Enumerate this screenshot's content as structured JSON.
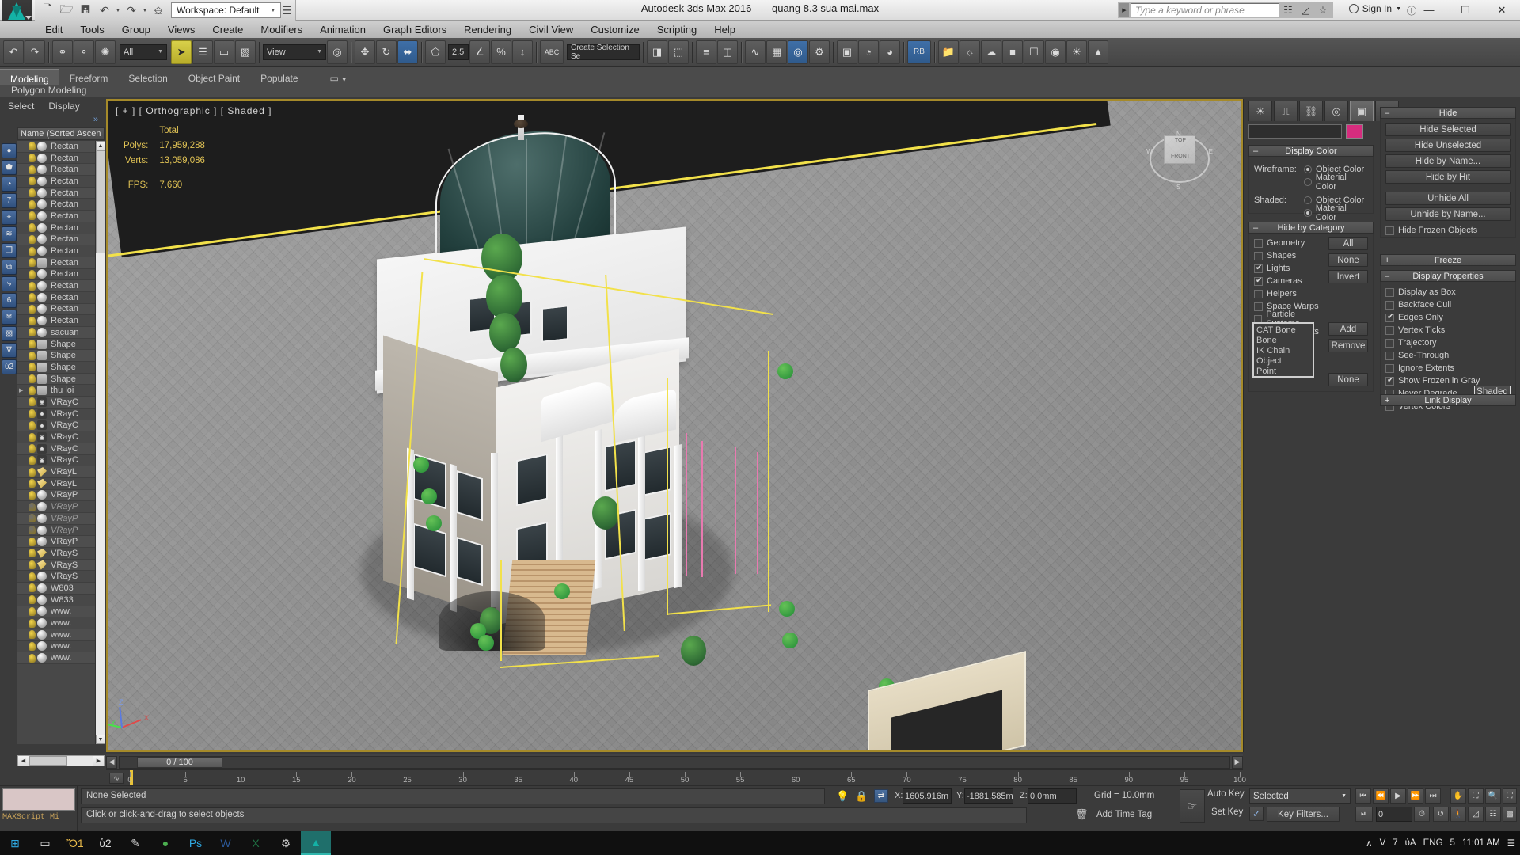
{
  "titlebar": {
    "app_title": "Autodesk 3ds Max 2016",
    "file_name": "quang 8.3 sua mai.max",
    "workspace": "Workspace: Default",
    "search_placeholder": "Type a keyword or phrase",
    "sign_in": "Sign In",
    "logo_label": "MAX",
    "quick_access": [
      {
        "name": "new-file-icon",
        "glyph": "☐"
      },
      {
        "name": "open-file-icon",
        "glyph": "Ὄ2"
      },
      {
        "name": "save-file-icon",
        "glyph": "ὋE"
      },
      {
        "name": "undo-icon",
        "glyph": "↶"
      },
      {
        "name": "redo-icon",
        "glyph": "↷"
      },
      {
        "name": "set-project-folder-icon",
        "glyph": "⌸"
      }
    ],
    "right_icons": [
      {
        "name": "search-binoculars-icon",
        "glyph": "⋈"
      },
      {
        "name": "communication-center-icon",
        "glyph": "⧉"
      },
      {
        "name": "favorites-star-icon",
        "glyph": "☆"
      },
      {
        "name": "help-icon",
        "glyph": "?"
      }
    ],
    "window_buttons": [
      {
        "name": "minimize-button",
        "glyph": "—"
      },
      {
        "name": "restore-button",
        "glyph": "❐"
      },
      {
        "name": "close-button",
        "glyph": "✕"
      }
    ]
  },
  "menubar": {
    "items": [
      "Edit",
      "Tools",
      "Group",
      "Views",
      "Create",
      "Modifiers",
      "Animation",
      "Graph Editors",
      "Rendering",
      "Civil View",
      "Customize",
      "Scripting",
      "Help"
    ]
  },
  "toolbar": {
    "selection_filter": "All",
    "reference_coord": "View",
    "angle_snap_value": "2.5",
    "named_selection_placeholder": "Create Selection Se",
    "buttons": [
      {
        "name": "undo-scene-op-icon",
        "glyph": "↶"
      },
      {
        "name": "redo-scene-op-icon",
        "glyph": "↷"
      },
      {
        "name": "select-link-icon",
        "glyph": "⚭"
      },
      {
        "name": "unlink-selection-icon",
        "glyph": "⚬"
      },
      {
        "name": "bind-space-warp-icon",
        "glyph": "✲"
      },
      {
        "name": "select-object-icon",
        "glyph": "➤"
      },
      {
        "name": "select-by-name-icon",
        "glyph": "☰"
      },
      {
        "name": "rectangular-select-region-icon",
        "glyph": "▭"
      },
      {
        "name": "window-crossing-icon",
        "glyph": "▧"
      },
      {
        "name": "select-and-move-icon",
        "glyph": "✥"
      },
      {
        "name": "select-and-rotate-icon",
        "glyph": "↻"
      },
      {
        "name": "select-and-scale-icon",
        "glyph": "⬌"
      },
      {
        "name": "snaps-toggle-icon",
        "glyph": "⬠"
      },
      {
        "name": "angle-snap-toggle-icon",
        "glyph": "∠"
      },
      {
        "name": "percent-snap-toggle-icon",
        "glyph": "%"
      },
      {
        "name": "spinner-snap-toggle-icon",
        "glyph": "↕"
      },
      {
        "name": "edit-named-selection-icon",
        "glyph": "ABC"
      },
      {
        "name": "mirror-icon",
        "glyph": "⧉"
      },
      {
        "name": "align-icon",
        "glyph": "⬚"
      },
      {
        "name": "layer-explorer-icon",
        "glyph": "≡"
      },
      {
        "name": "curve-editor-icon",
        "glyph": "∿"
      },
      {
        "name": "schematic-view-icon",
        "glyph": "▦"
      },
      {
        "name": "material-editor-icon",
        "glyph": "◎"
      },
      {
        "name": "render-setup-icon",
        "glyph": "⚙"
      },
      {
        "name": "rendered-frame-window-icon",
        "glyph": "▣"
      },
      {
        "name": "render-production-icon",
        "glyph": "☕"
      },
      {
        "name": "render-iterative-icon",
        "glyph": "◑"
      },
      {
        "name": "activeshade-icon",
        "glyph": "◕"
      },
      {
        "name": "project-folder-icon",
        "glyph": "Ὄ1"
      },
      {
        "name": "ribbon-toggle-icon",
        "glyph": "RB"
      }
    ]
  },
  "ribbon": {
    "tabs": [
      {
        "label": "Modeling",
        "active": true
      },
      {
        "label": "Freeform",
        "active": false
      },
      {
        "label": "Selection",
        "active": false
      },
      {
        "label": "Object Paint",
        "active": false
      },
      {
        "label": "Populate",
        "active": false
      }
    ],
    "panel_label": "Polygon Modeling"
  },
  "explorer": {
    "tabs": [
      "Select",
      "Display"
    ],
    "column_header": "Name (Sorted Ascen",
    "side_tools": [
      {
        "name": "select-all-icon",
        "glyph": "●"
      },
      {
        "name": "select-geometry-icon",
        "glyph": "⬟"
      },
      {
        "name": "select-lights-icon",
        "glyph": "◔"
      },
      {
        "name": "select-cameras-icon",
        "glyph": "὏7"
      },
      {
        "name": "select-helpers-icon",
        "glyph": "⌖"
      },
      {
        "name": "select-spacewarps-icon",
        "glyph": "≋"
      },
      {
        "name": "select-groups-icon",
        "glyph": "❐"
      },
      {
        "name": "select-xrefs-icon",
        "glyph": "⧉"
      },
      {
        "name": "select-bones-icon",
        "glyph": "⤷"
      },
      {
        "name": "select-containers-icon",
        "glyph": "὎6"
      },
      {
        "name": "select-frozen-icon",
        "glyph": "❄"
      },
      {
        "name": "select-hidden-icon",
        "glyph": "▧"
      },
      {
        "name": "display-filter-icon",
        "glyph": "∇"
      },
      {
        "name": "lock-selection-icon",
        "glyph": "ὑ2"
      }
    ],
    "rows": [
      {
        "name": "Rectan",
        "type": "geom",
        "on": true
      },
      {
        "name": "Rectan",
        "type": "geom",
        "on": true
      },
      {
        "name": "Rectan",
        "type": "geom",
        "on": true
      },
      {
        "name": "Rectan",
        "type": "geom",
        "on": true
      },
      {
        "name": "Rectan",
        "type": "geom",
        "on": true
      },
      {
        "name": "Rectan",
        "type": "geom",
        "on": true
      },
      {
        "name": "Rectan",
        "type": "geom",
        "on": true
      },
      {
        "name": "Rectan",
        "type": "geom",
        "on": true
      },
      {
        "name": "Rectan",
        "type": "geom",
        "on": true
      },
      {
        "name": "Rectan",
        "type": "geom",
        "on": true
      },
      {
        "name": "Rectan",
        "type": "shape",
        "on": true
      },
      {
        "name": "Rectan",
        "type": "geom",
        "on": true
      },
      {
        "name": "Rectan",
        "type": "geom",
        "on": true
      },
      {
        "name": "Rectan",
        "type": "geom",
        "on": true
      },
      {
        "name": "Rectan",
        "type": "geom",
        "on": true
      },
      {
        "name": "Rectan",
        "type": "geom",
        "on": true
      },
      {
        "name": "sacuan",
        "type": "geom",
        "on": true
      },
      {
        "name": "Shape",
        "type": "shape",
        "on": true
      },
      {
        "name": "Shape",
        "type": "shape",
        "on": true
      },
      {
        "name": "Shape",
        "type": "shape",
        "on": true
      },
      {
        "name": "Shape",
        "type": "shape",
        "on": true
      },
      {
        "name": "thu loi",
        "type": "group",
        "on": true,
        "expander": true
      },
      {
        "name": "VRayC",
        "type": "cam",
        "on": true
      },
      {
        "name": "VRayC",
        "type": "cam",
        "on": true
      },
      {
        "name": "VRayC",
        "type": "cam",
        "on": true
      },
      {
        "name": "VRayC",
        "type": "cam",
        "on": true
      },
      {
        "name": "VRayC",
        "type": "cam",
        "on": true
      },
      {
        "name": "VRayC",
        "type": "cam",
        "on": true
      },
      {
        "name": "VRayL",
        "type": "light",
        "on": true
      },
      {
        "name": "VRayL",
        "type": "light",
        "on": true
      },
      {
        "name": "VRayP",
        "type": "geom",
        "on": true
      },
      {
        "name": "VRayP",
        "type": "geom",
        "on": false
      },
      {
        "name": "VRayP",
        "type": "geom",
        "on": false
      },
      {
        "name": "VRayP",
        "type": "geom",
        "on": false
      },
      {
        "name": "VRayP",
        "type": "geom",
        "on": true
      },
      {
        "name": "VRayS",
        "type": "light",
        "on": true
      },
      {
        "name": "VRayS",
        "type": "light",
        "on": true
      },
      {
        "name": "VRayS",
        "type": "geom",
        "on": true
      },
      {
        "name": "W803",
        "type": "geom",
        "on": true
      },
      {
        "name": "W833",
        "type": "geom",
        "on": true
      },
      {
        "name": "www.",
        "type": "geom",
        "on": true
      },
      {
        "name": "www.",
        "type": "geom",
        "on": true
      },
      {
        "name": "www.",
        "type": "geom",
        "on": true
      },
      {
        "name": "www.",
        "type": "geom",
        "on": true
      },
      {
        "name": "www.",
        "type": "geom",
        "on": true
      }
    ]
  },
  "viewport": {
    "label": "[ + ] [ Orthographic ] [ Shaded ]",
    "stats": {
      "header": "Total",
      "polys_label": "Polys:",
      "polys_value": "17,959,288",
      "verts_label": "Verts:",
      "verts_value": "13,059,086",
      "fps_label": "FPS:",
      "fps_value": "7.660"
    },
    "viewcube": {
      "top": "TOP",
      "front": "FRONT",
      "n": "N",
      "e": "E",
      "s": "S",
      "w": "W"
    },
    "axis": {
      "x": "X",
      "y": "Y",
      "z": "Z"
    }
  },
  "command_panel": {
    "tabs": [
      {
        "name": "create-tab",
        "glyph": "☀",
        "active": false
      },
      {
        "name": "modify-tab",
        "glyph": "⎍",
        "active": false
      },
      {
        "name": "hierarchy-tab",
        "glyph": "⛓",
        "active": false
      },
      {
        "name": "motion-tab",
        "glyph": "◎",
        "active": false
      },
      {
        "name": "display-tab",
        "glyph": "▣",
        "active": true
      },
      {
        "name": "utilities-tab",
        "glyph": "⚒",
        "active": false
      }
    ],
    "object_name": "",
    "object_color": "#d62c7e",
    "display_color": {
      "title": "Display Color",
      "wireframe_label": "Wireframe:",
      "shaded_label": "Shaded:",
      "options": [
        "Object Color",
        "Material Color"
      ],
      "wireframe_selected": "Object Color",
      "shaded_selected": "Material Color"
    },
    "hide_by_category": {
      "title": "Hide by Category",
      "items": [
        {
          "label": "Geometry",
          "checked": false
        },
        {
          "label": "Shapes",
          "checked": false
        },
        {
          "label": "Lights",
          "checked": true
        },
        {
          "label": "Cameras",
          "checked": true
        },
        {
          "label": "Helpers",
          "checked": false
        },
        {
          "label": "Space Warps",
          "checked": false
        },
        {
          "label": "Particle Systems",
          "checked": false
        },
        {
          "label": "Bone Objects",
          "checked": false
        }
      ],
      "buttons": [
        "All",
        "None",
        "Invert"
      ],
      "list_items": [
        "CAT Bone",
        "Bone",
        "IK Chain Object",
        "Point"
      ],
      "side_buttons": [
        "Add",
        "Remove",
        "None"
      ]
    },
    "hide": {
      "title": "Hide",
      "buttons": [
        "Hide Selected",
        "Hide Unselected",
        "Hide by Name...",
        "Hide by Hit",
        "Unhide All",
        "Unhide by Name..."
      ],
      "checkbox": {
        "label": "Hide Frozen Objects",
        "checked": false
      }
    },
    "freeze": {
      "title": "Freeze",
      "collapsed": true
    },
    "display_properties": {
      "title": "Display Properties",
      "items": [
        {
          "label": "Display as Box",
          "checked": false
        },
        {
          "label": "Backface Cull",
          "checked": false
        },
        {
          "label": "Edges Only",
          "checked": true
        },
        {
          "label": "Vertex Ticks",
          "checked": false
        },
        {
          "label": "Trajectory",
          "checked": false
        },
        {
          "label": "See-Through",
          "checked": false
        },
        {
          "label": "Ignore Extents",
          "checked": false
        },
        {
          "label": "Show Frozen in Gray",
          "checked": true
        },
        {
          "label": "Never Degrade",
          "checked": false
        },
        {
          "label": "Vertex Colors",
          "checked": false
        }
      ],
      "shaded_button": "Shaded"
    },
    "link_display": {
      "title": "Link Display",
      "collapsed": true
    }
  },
  "timeline": {
    "current_frame_label": "0 / 100",
    "ticks": [
      0,
      5,
      10,
      15,
      20,
      25,
      30,
      35,
      40,
      45,
      50,
      55,
      60,
      65,
      70,
      75,
      80,
      85,
      90,
      95,
      100
    ]
  },
  "statusbar": {
    "maxscript_label": "MAXScript Mi",
    "selection_status": "None Selected",
    "prompt": "Click or click-and-drag to select objects",
    "coords": [
      {
        "axis": "X:",
        "value": "1605.916m"
      },
      {
        "axis": "Y:",
        "value": "-1881.585m"
      },
      {
        "axis": "Z:",
        "value": "0.0mm"
      }
    ],
    "grid": "Grid = 10.0mm",
    "add_time_tag": "Add Time Tag",
    "auto_key": "Auto Key",
    "set_key": "Set Key",
    "selected_combo": "Selected",
    "key_filters": "Key Filters...",
    "key_value": "0"
  },
  "taskbar": {
    "items": [
      {
        "name": "start-button-icon",
        "glyph": "⊞",
        "color": "#2fa8e0"
      },
      {
        "name": "task-view-icon",
        "glyph": "▭",
        "color": "#d8d8d8"
      },
      {
        "name": "file-explorer-icon",
        "glyph": "Ὄ1",
        "color": "#e8b94a"
      },
      {
        "name": "lock-app-icon",
        "glyph": "ὑ2",
        "color": "#d8d8d8"
      },
      {
        "name": "paint-app-icon",
        "glyph": "✎",
        "color": "#cfcfcf"
      },
      {
        "name": "browser-icon",
        "glyph": "●",
        "color": "#4caf50"
      },
      {
        "name": "photoshop-icon",
        "glyph": "Ps",
        "color": "#2fa8e0"
      },
      {
        "name": "word-icon",
        "glyph": "W",
        "color": "#2b5797"
      },
      {
        "name": "excel-icon",
        "glyph": "X",
        "color": "#1f7244"
      },
      {
        "name": "settings-icon",
        "glyph": "⚙",
        "color": "#bdbdbd"
      },
      {
        "name": "3dsmax-taskbar-icon",
        "glyph": "▲",
        "color": "#14b2a6"
      }
    ],
    "tray": [
      {
        "name": "show-hidden-icons",
        "glyph": "∧"
      },
      {
        "name": "antivirus-icon",
        "glyph": "V"
      },
      {
        "name": "network-icon",
        "glyph": "὚7"
      },
      {
        "name": "volume-icon",
        "glyph": "ὐA"
      },
      {
        "name": "language-indicator",
        "glyph": "ENG"
      },
      {
        "name": "action-center-icon",
        "glyph": "὚5"
      }
    ],
    "clock": "11:01 AM"
  }
}
